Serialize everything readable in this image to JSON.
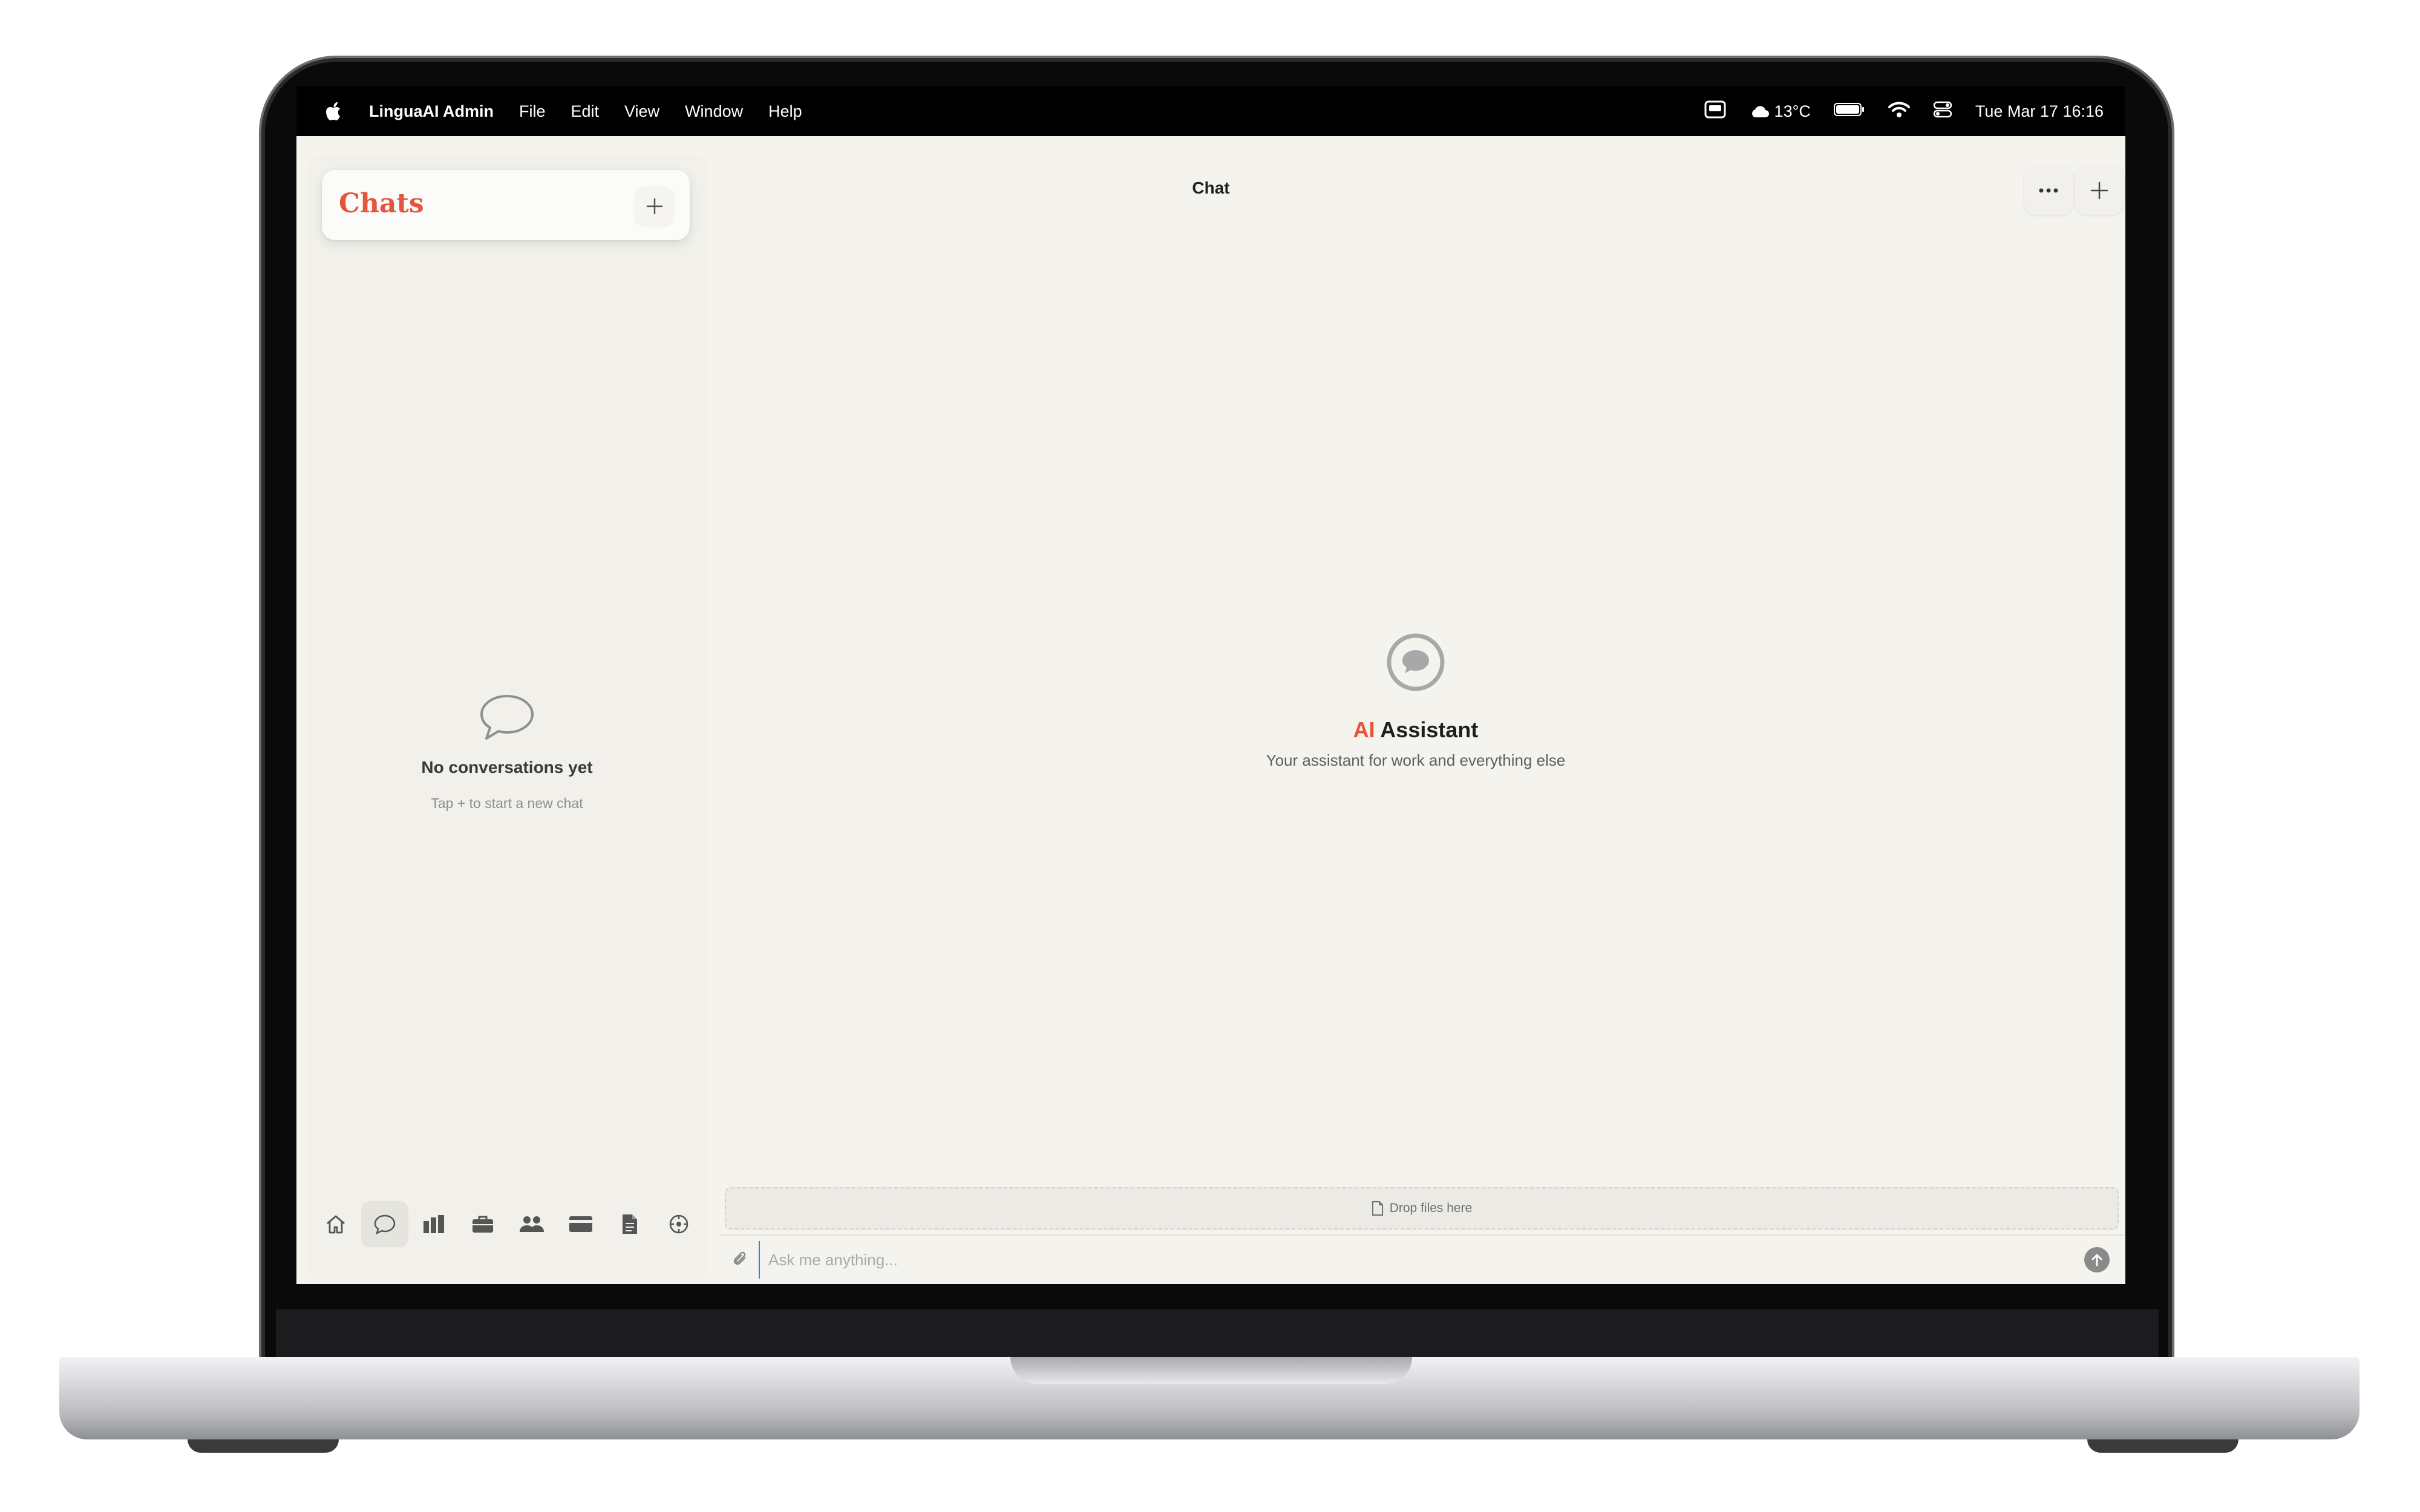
{
  "menubar": {
    "app_name": "LinguaAI Admin",
    "menus": [
      "File",
      "Edit",
      "View",
      "Window",
      "Help"
    ],
    "weather": "13°C",
    "datetime": "Tue Mar 17  16:16"
  },
  "sidebar": {
    "title": "Chats",
    "empty_title": "No conversations yet",
    "empty_subtitle": "Tap + to start a new chat",
    "nav_items": [
      "home-icon",
      "chat-icon",
      "bar-chart-icon",
      "briefcase-icon",
      "users-icon",
      "credit-card-icon",
      "document-icon",
      "settings-icon"
    ],
    "active_nav": "chat-icon"
  },
  "main": {
    "title": "Chat",
    "assistant_accent": "AI",
    "assistant_name": "Assistant",
    "assistant_subtitle": "Your assistant for work and everything else",
    "drop_label": "Drop files here",
    "input_placeholder": "Ask me anything..."
  },
  "colors": {
    "accent": "#e5553c",
    "background": "#f4f3ee"
  }
}
